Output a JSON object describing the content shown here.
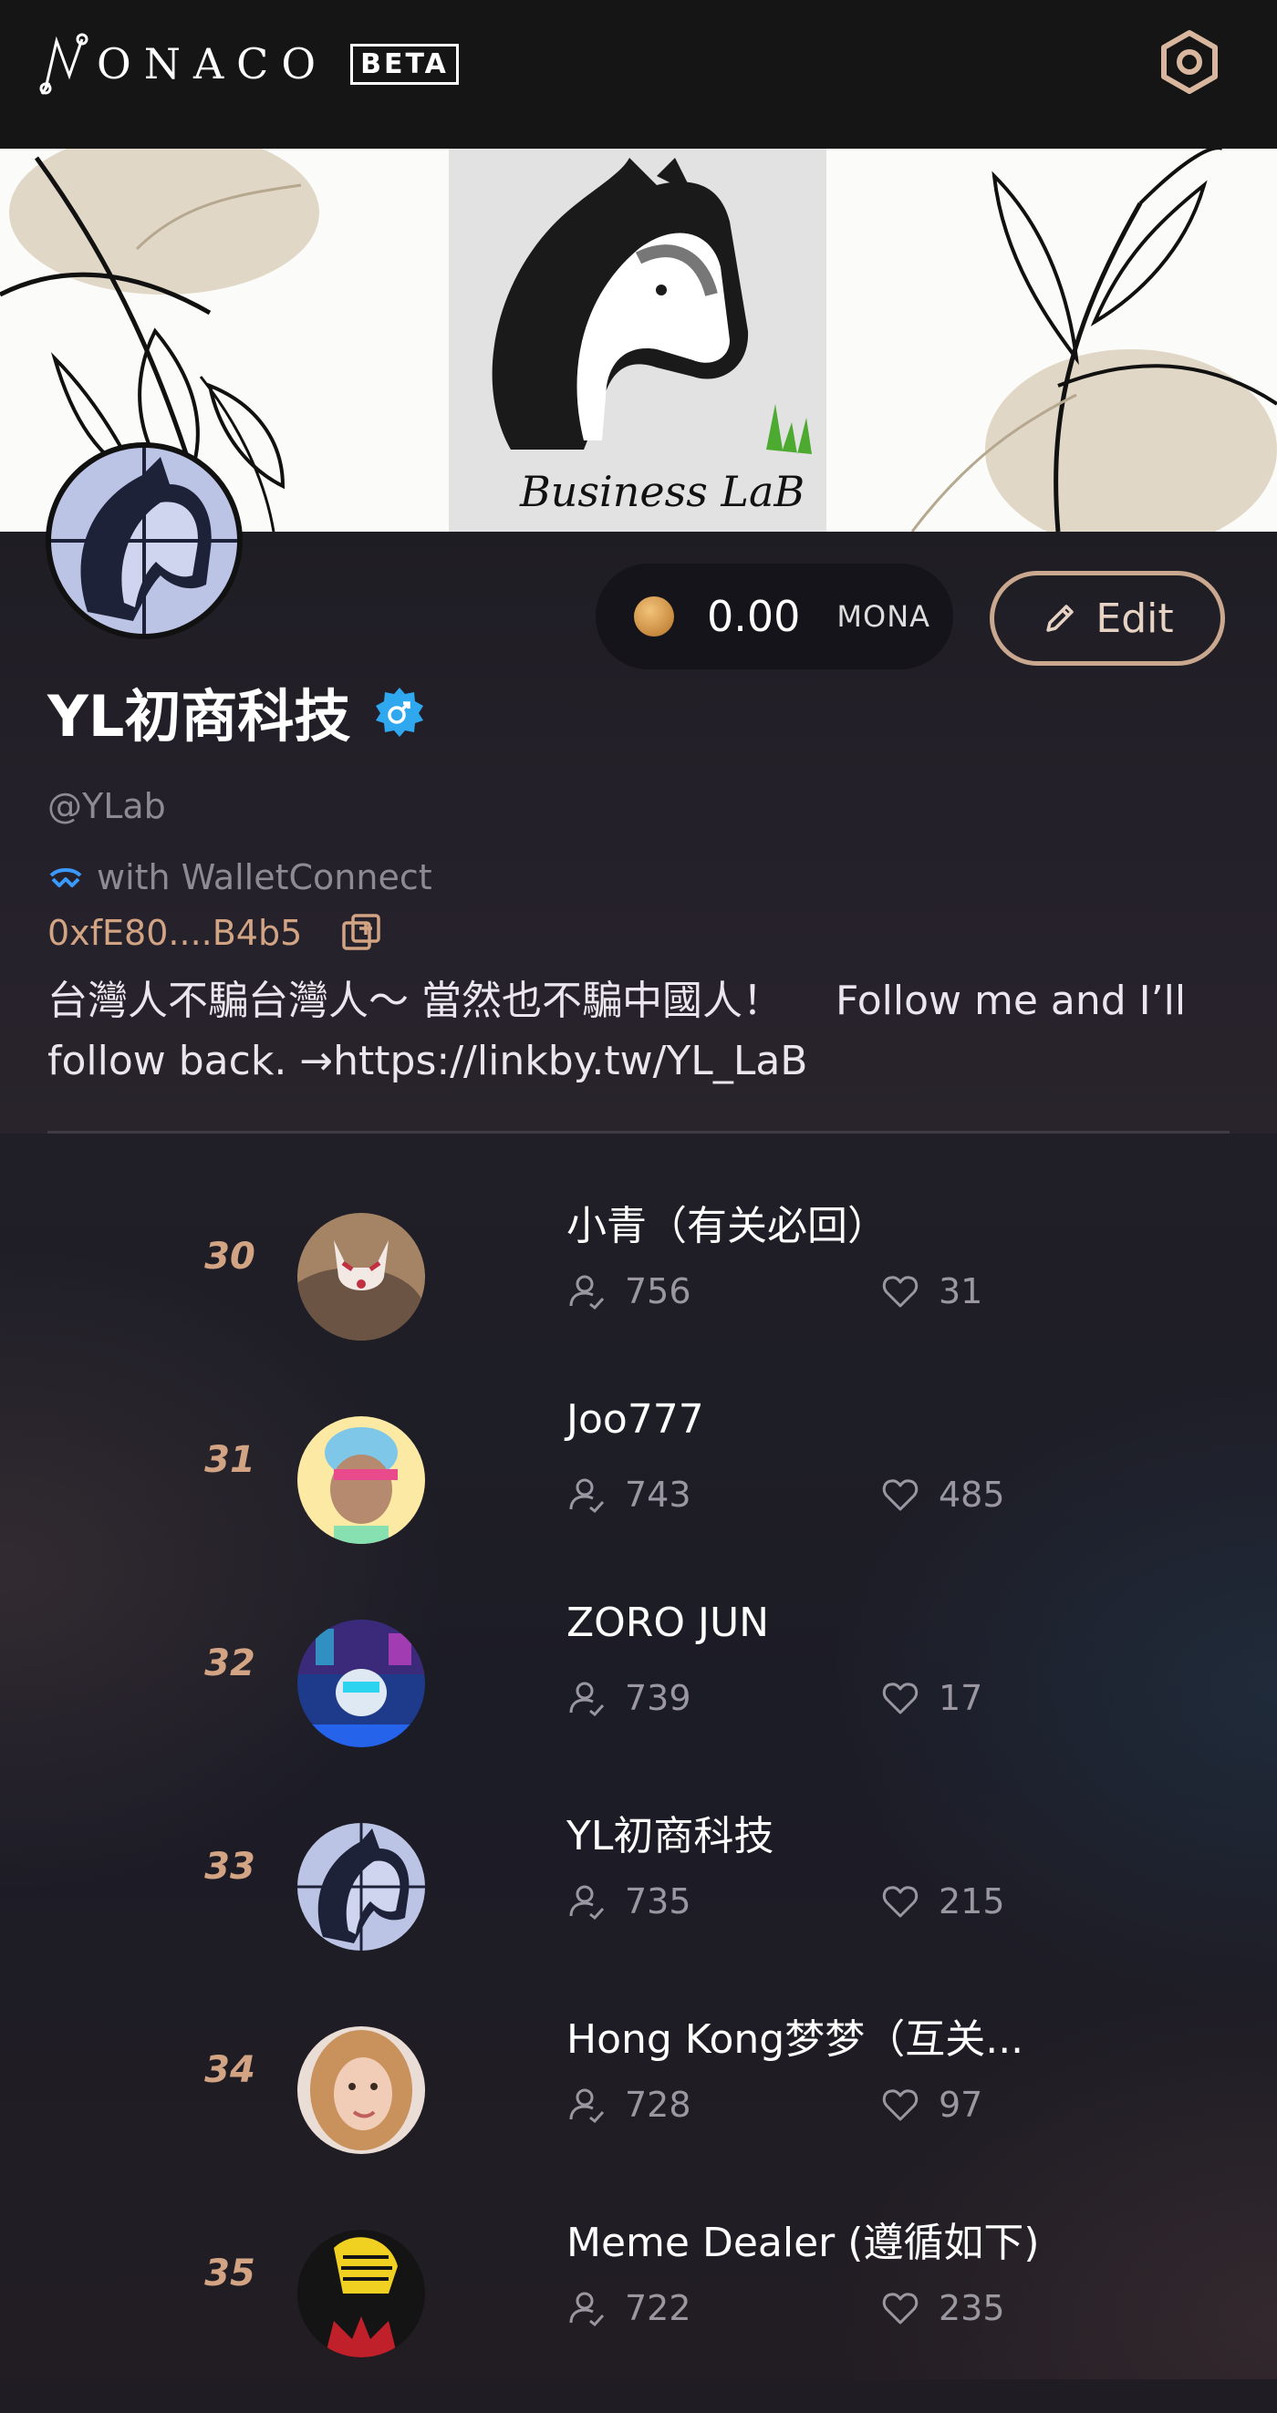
{
  "header": {
    "logo_text": "ONACO",
    "beta_label": "BETA"
  },
  "banner": {
    "brand_text": "Business LaB"
  },
  "wallet": {
    "balance": "0.00",
    "unit": "MONA"
  },
  "edit_label": "Edit",
  "profile": {
    "name": "YL初商科技",
    "handle": "@YLab",
    "wallet_provider": "with WalletConnect",
    "address": "0xfE80....B4b5",
    "bio": "台灣人不騙台灣人～ 當然也不騙中國人！　 Follow me and I’ll follow back. →https://linkby.tw/YL_LaB"
  },
  "colors": {
    "accent": "#d2a484",
    "verified": "#2fa8f0"
  },
  "rows": [
    {
      "rank": "30",
      "name": "小青（有关必回）",
      "followers": "756",
      "likes": "31"
    },
    {
      "rank": "31",
      "name": "Joo777",
      "followers": "743",
      "likes": "485"
    },
    {
      "rank": "32",
      "name": "ZORO JUN",
      "followers": "739",
      "likes": "17"
    },
    {
      "rank": "33",
      "name": "YL初商科技",
      "followers": "735",
      "likes": "215"
    },
    {
      "rank": "34",
      "name": "Hong Kong梦梦（互关...",
      "followers": "728",
      "likes": "97"
    },
    {
      "rank": "35",
      "name": "Meme Dealer (遵循如下)",
      "followers": "722",
      "likes": "235"
    }
  ]
}
